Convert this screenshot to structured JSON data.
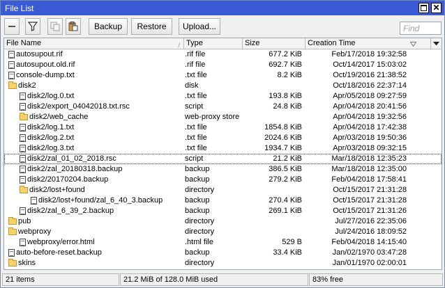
{
  "window": {
    "title": "File List"
  },
  "toolbar": {
    "backup_label": "Backup",
    "restore_label": "Restore",
    "upload_label": "Upload...",
    "find_placeholder": "Find"
  },
  "columns": {
    "name": "File Name",
    "type": "Type",
    "size": "Size",
    "time": "Creation Time"
  },
  "rows": [
    {
      "name": "autosupout.rif",
      "type": ".rif file",
      "size": "677.2 KiB",
      "time": "Feb/17/2018 19:32:58",
      "kind": "file",
      "depth": 0
    },
    {
      "name": "autosupout.old.rif",
      "type": ".rif file",
      "size": "692.7 KiB",
      "time": "Oct/14/2017 15:03:02",
      "kind": "file",
      "depth": 0
    },
    {
      "name": "console-dump.txt",
      "type": ".txt file",
      "size": "8.2 KiB",
      "time": "Oct/19/2016 21:38:52",
      "kind": "file",
      "depth": 0
    },
    {
      "name": "disk2",
      "type": "disk",
      "size": "",
      "time": "Oct/18/2016 22:37:14",
      "kind": "folder",
      "depth": 0
    },
    {
      "name": "disk2/log.0.txt",
      "type": ".txt file",
      "size": "193.8 KiB",
      "time": "Apr/05/2018 09:27:59",
      "kind": "file",
      "depth": 1
    },
    {
      "name": "disk2/export_04042018.txt.rsc",
      "type": "script",
      "size": "24.8 KiB",
      "time": "Apr/04/2018 20:41:56",
      "kind": "file",
      "depth": 1
    },
    {
      "name": "disk2/web_cache",
      "type": "web-proxy store",
      "size": "",
      "time": "Apr/04/2018 19:32:56",
      "kind": "folder",
      "depth": 1
    },
    {
      "name": "disk2/log.1.txt",
      "type": ".txt file",
      "size": "1854.8 KiB",
      "time": "Apr/04/2018 17:42:38",
      "kind": "file",
      "depth": 1
    },
    {
      "name": "disk2/log.2.txt",
      "type": ".txt file",
      "size": "2024.6 KiB",
      "time": "Apr/03/2018 19:50:36",
      "kind": "file",
      "depth": 1
    },
    {
      "name": "disk2/log.3.txt",
      "type": ".txt file",
      "size": "1934.7 KiB",
      "time": "Apr/03/2018 09:32:15",
      "kind": "file",
      "depth": 1
    },
    {
      "name": "disk2/zal_01_02_2018.rsc",
      "type": "script",
      "size": "21.2 KiB",
      "time": "Mar/18/2018 12:35:23",
      "kind": "file",
      "depth": 1
    },
    {
      "name": "disk2/zal_20180318.backup",
      "type": "backup",
      "size": "386.5 KiB",
      "time": "Mar/18/2018 12:35:00",
      "kind": "file",
      "depth": 1
    },
    {
      "name": "disk2/20170204.backup",
      "type": "backup",
      "size": "279.2 KiB",
      "time": "Feb/04/2018 17:58:41",
      "kind": "file",
      "depth": 1
    },
    {
      "name": "disk2/lost+found",
      "type": "directory",
      "size": "",
      "time": "Oct/15/2017 21:31:28",
      "kind": "folder",
      "depth": 1
    },
    {
      "name": "disk2/lost+found/zal_6_40_3.backup",
      "type": "backup",
      "size": "270.4 KiB",
      "time": "Oct/15/2017 21:31:28",
      "kind": "file",
      "depth": 2
    },
    {
      "name": "disk2/zal_6_39_2.backup",
      "type": "backup",
      "size": "269.1 KiB",
      "time": "Oct/15/2017 21:31:26",
      "kind": "file",
      "depth": 1
    },
    {
      "name": "pub",
      "type": "directory",
      "size": "",
      "time": "Jul/27/2016 22:35:06",
      "kind": "folder",
      "depth": 0
    },
    {
      "name": "webproxy",
      "type": "directory",
      "size": "",
      "time": "Jul/24/2016 18:09:52",
      "kind": "folder",
      "depth": 0
    },
    {
      "name": "webproxy/error.html",
      "type": ".html file",
      "size": "529 B",
      "time": "Feb/04/2018 14:15:40",
      "kind": "file",
      "depth": 1
    },
    {
      "name": "auto-before-reset.backup",
      "type": "backup",
      "size": "33.4 KiB",
      "time": "Jan/02/1970 03:47:28",
      "kind": "file",
      "depth": 0
    },
    {
      "name": "skins",
      "type": "directory",
      "size": "",
      "time": "Jan/01/1970 02:00:01",
      "kind": "folder",
      "depth": 0
    }
  ],
  "selected_row": "disk2/zal_01_02_2018.rsc",
  "status": {
    "count": "21 items",
    "usage": "21.2 MiB of 128.0 MiB used",
    "free": "83% free"
  }
}
